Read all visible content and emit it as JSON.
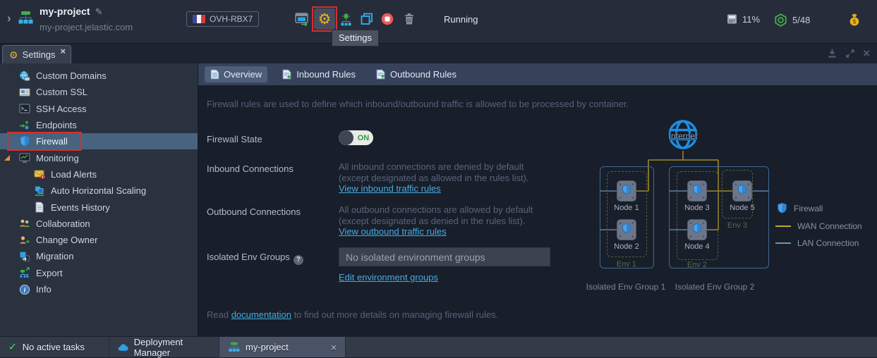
{
  "header": {
    "project_name": "my-project",
    "project_domain": "my-project.jelastic.com",
    "region": "OVH-RBX7",
    "status": "Running",
    "settings_tooltip": "Settings",
    "disk_usage": "11%",
    "cloudlets": "5/48"
  },
  "panel": {
    "tab_label": "Settings"
  },
  "icons": {
    "pencil": "✎",
    "gear": "⚙",
    "close": "×",
    "check": "✓",
    "chevron": "›",
    "help": "?"
  },
  "sidebar": {
    "items": [
      {
        "label": "Custom Domains",
        "icon": "globe"
      },
      {
        "label": "Custom SSL",
        "icon": "certificate"
      },
      {
        "label": "SSH Access",
        "icon": "terminal"
      },
      {
        "label": "Endpoints",
        "icon": "endpoints"
      },
      {
        "label": "Firewall",
        "icon": "shield",
        "selected": true
      },
      {
        "label": "Monitoring",
        "icon": "monitor",
        "expanded": true
      },
      {
        "label": "Load Alerts",
        "icon": "mail-alert",
        "indent": true
      },
      {
        "label": "Auto Horizontal Scaling",
        "icon": "cubes-scaling",
        "indent": true
      },
      {
        "label": "Events History",
        "icon": "document",
        "indent": true
      },
      {
        "label": "Collaboration",
        "icon": "people"
      },
      {
        "label": "Change Owner",
        "icon": "person-arrow"
      },
      {
        "label": "Migration",
        "icon": "migrate"
      },
      {
        "label": "Export",
        "icon": "export"
      },
      {
        "label": "Info",
        "icon": "info"
      }
    ]
  },
  "content": {
    "tabs": [
      {
        "label": "Overview"
      },
      {
        "label": "Inbound Rules"
      },
      {
        "label": "Outbound Rules"
      }
    ],
    "description": "Firewall rules are used to define which inbound/outbound traffic is allowed to be processed by container.",
    "firewall_state": {
      "label": "Firewall State",
      "value": "ON"
    },
    "inbound": {
      "label": "Inbound Connections",
      "line1": "All inbound connections are denied by default",
      "line2": "(except designated as allowed in the rules list).",
      "link": "View inbound traffic rules"
    },
    "outbound": {
      "label": "Outbound Connections",
      "line1": "All outbound connections are allowed by default",
      "line2": "(except designated as denied in the rules list).",
      "link": "View outbound traffic rules"
    },
    "isolated": {
      "label": "Isolated Env Groups",
      "value": "No isolated environment groups",
      "link": "Edit environment groups"
    },
    "footer": {
      "prefix": "Read ",
      "link": "documentation",
      "suffix": " to find out more details on managing firewall rules."
    }
  },
  "diagram": {
    "internet_label": "Internet",
    "nodes": [
      "Node 1",
      "Node 2",
      "Node 3",
      "Node 4",
      "Node 5"
    ],
    "envs": [
      "Env 1",
      "Env 2",
      "Env 3"
    ],
    "groups": [
      "Isolated Env Group 1",
      "Isolated Env Group 2"
    ],
    "legend": [
      {
        "label": "Firewall"
      },
      {
        "label": "WAN Connection"
      },
      {
        "label": "LAN Connection"
      }
    ]
  },
  "taskbar": {
    "tasks": "No active tasks",
    "deployment": "Deployment Manager",
    "project": "my-project"
  },
  "colors": {
    "annotation_red": "#d32f2f",
    "link_blue": "#45ace3",
    "toggle_on_green": "#2f9e3f",
    "wan_yellow": "#c3a82e",
    "lan_blue": "#6f95b5",
    "shield_blue": "#4fa0e8",
    "gear_yellow": "#e8b320",
    "selected_row_blue": "#47637f"
  }
}
